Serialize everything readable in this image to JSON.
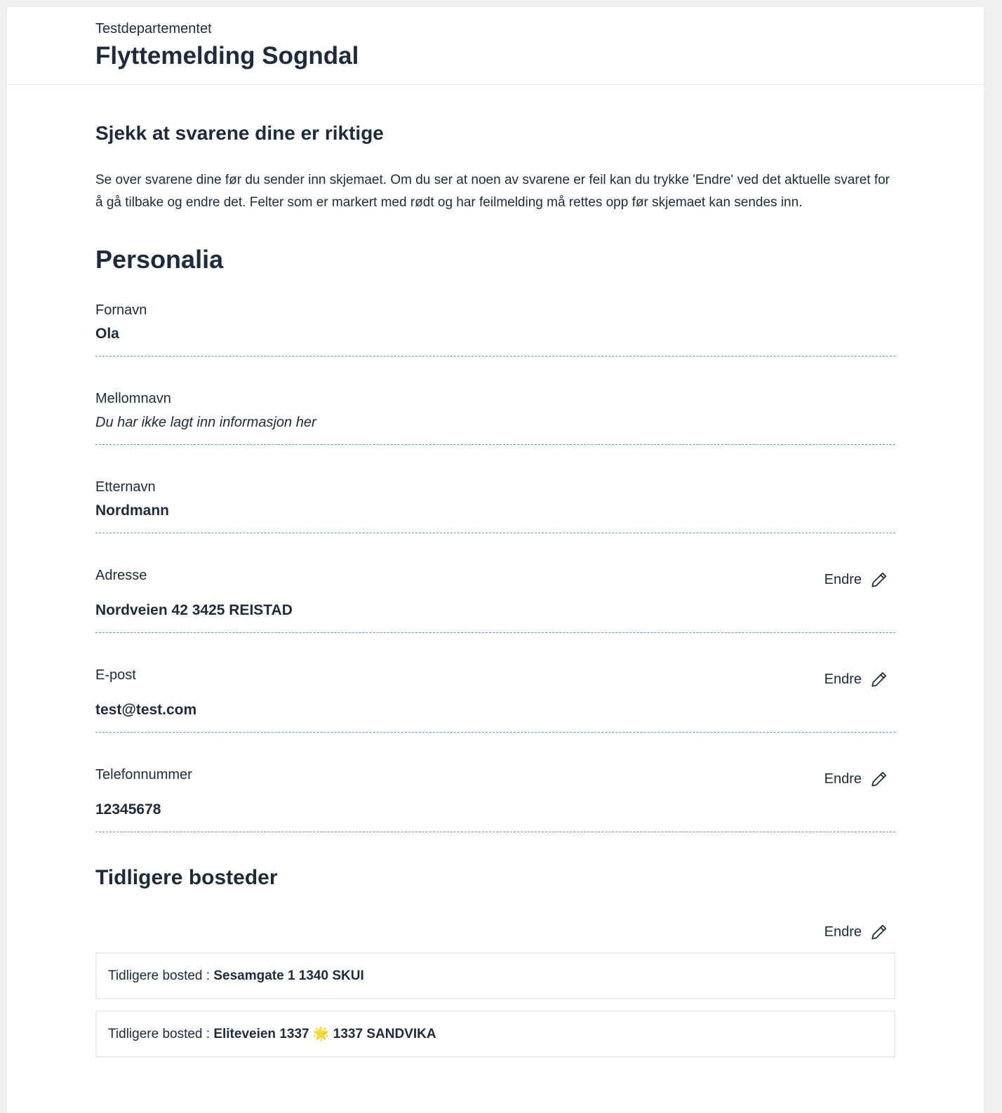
{
  "header": {
    "organisation": "Testdepartementet",
    "title": "Flyttemelding Sogndal"
  },
  "summary": {
    "title": "Sjekk at svarene dine er riktige",
    "intro": "Se over svarene dine før du sender inn skjemaet. Om du ser at noen av svarene er feil kan du trykke 'Endre' ved det aktuelle svaret for å gå tilbake og endre det. Felter som er markert med rødt og har feilmelding må rettes opp før skjemaet kan sendes inn."
  },
  "personalia": {
    "title": "Personalia",
    "fields": [
      {
        "label": "Fornavn",
        "value": "Ola"
      },
      {
        "label": "Mellomnavn",
        "value": "Du har ikke lagt inn informasjon her"
      },
      {
        "label": "Etternavn",
        "value": "Nordmann"
      },
      {
        "label": "Adresse",
        "value": "Nordveien 42 3425 REISTAD",
        "edit_label": "Endre"
      },
      {
        "label": "E-post",
        "value": "test@test.com",
        "edit_label": "Endre"
      },
      {
        "label": "Telefonnummer",
        "value": "12345678",
        "edit_label": "Endre"
      }
    ]
  },
  "previous_residences": {
    "title": "Tidligere bosteder",
    "edit_label": "Endre",
    "items": [
      {
        "label": "Tidligere bosted : ",
        "value": "Sesamgate 1 1340 SKUI"
      },
      {
        "label": "Tidligere bosted : ",
        "value": "Eliteveien 1337 🌟 1337 SANDVIKA"
      }
    ]
  },
  "icons": {
    "edit": "pencil-icon"
  },
  "colors": {
    "text": "#1e2b3c",
    "divider": "#5a9bc9",
    "box_border": "#ececec"
  }
}
